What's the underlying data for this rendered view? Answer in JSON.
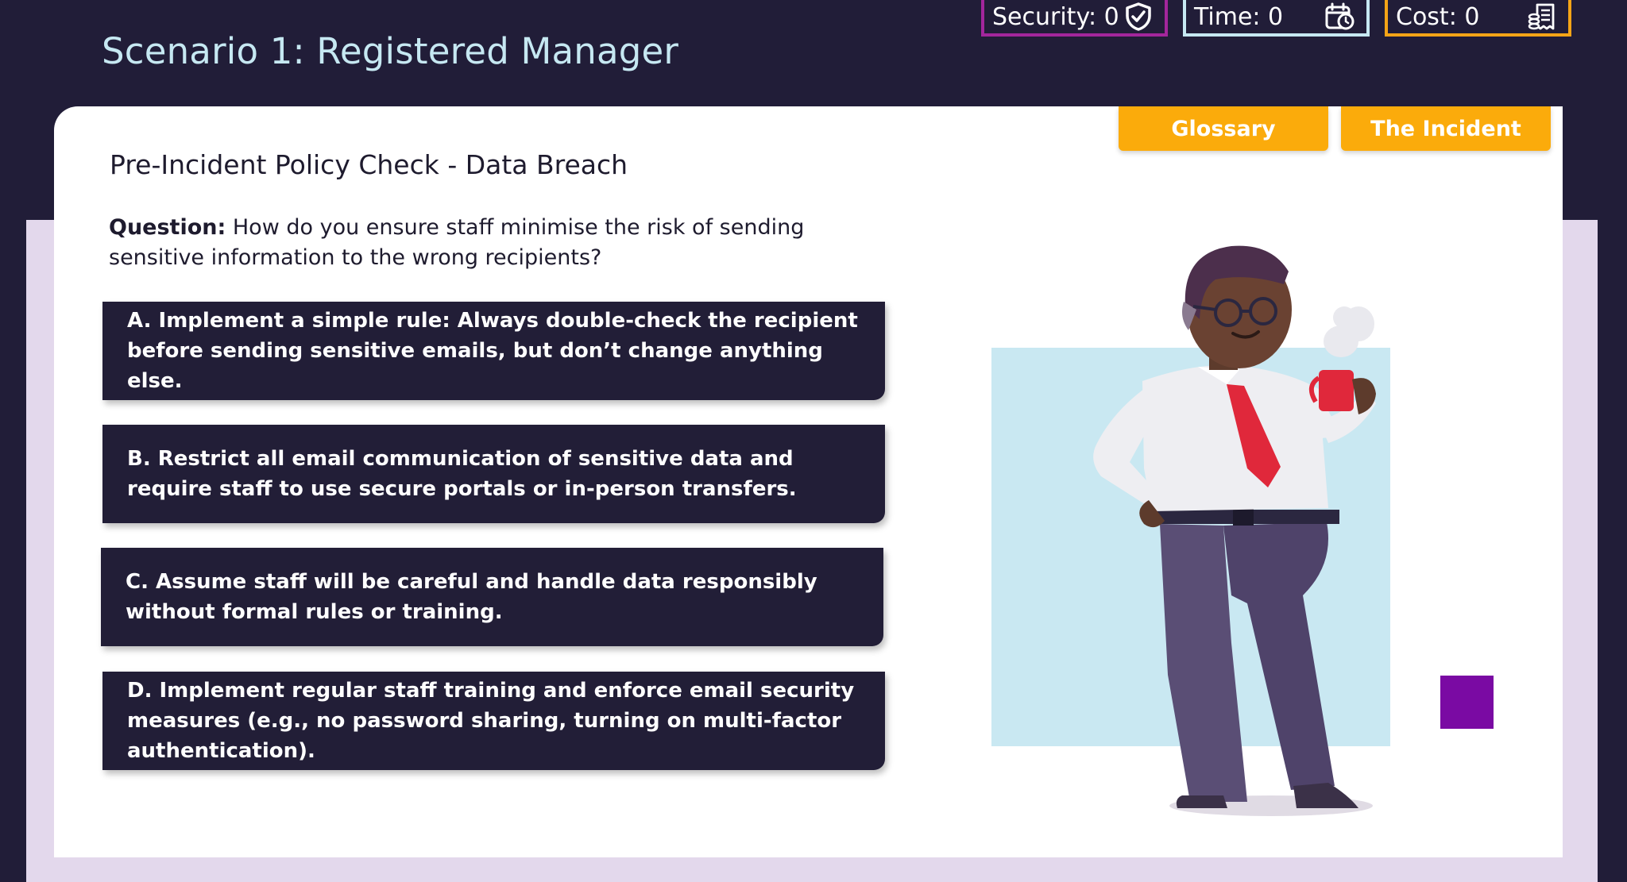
{
  "header": {
    "scenario_title": "Scenario 1: Registered Manager"
  },
  "stats": {
    "security": {
      "label": "Security: 0",
      "icon": "shield-check-icon",
      "color": "#a3269c"
    },
    "time": {
      "label": "Time: 0",
      "icon": "calendar-clock-icon",
      "color": "#c6e8f2"
    },
    "cost": {
      "label": "Cost: 0",
      "icon": "receipt-coins-icon",
      "color": "#f5a417"
    }
  },
  "tabs": {
    "glossary": "Glossary",
    "incident": "The Incident"
  },
  "main": {
    "section_title": "Pre-Incident Policy Check - Data Breach",
    "question_label": "Question:",
    "question_text": " How do you ensure staff minimise the risk of sending sensitive information to the wrong recipients?"
  },
  "options": [
    {
      "text": "A. Implement a simple rule: Always double-check the recipient before sending sensitive emails, but don’t change anything else."
    },
    {
      "text": "B. Restrict all email communication of sensitive data and require staff to use secure portals or in-person transfers."
    },
    {
      "text": "C. Assume staff will be careful and handle data responsibly without formal rules or training."
    },
    {
      "text": "D. Implement regular staff training and enforce email security measures (e.g., no password sharing, turning on multi-factor authentication)."
    }
  ],
  "illustration": {
    "icon": "manager-with-coffee-illustration"
  }
}
